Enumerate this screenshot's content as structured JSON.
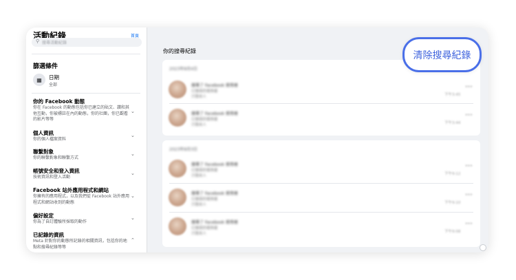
{
  "sidebar": {
    "title": "活動紀錄",
    "home_link": "首頁",
    "search_placeholder": "搜尋活動紀錄",
    "filter_title": "篩選條件",
    "date_filter": {
      "label": "日期",
      "value": "全部"
    },
    "categories": [
      {
        "title": "你的 Facebook 動態",
        "description": "你在 Facebook 的動態包括你已建立的貼文、讚和其他互動，你被標註在內的動態，你的社團，你已觀看的影片等等",
        "expanded": false
      },
      {
        "title": "個人資訊",
        "description": "你的個人檔案資料",
        "expanded": false
      },
      {
        "title": "聯繫對象",
        "description": "你的聯繫對象和聯繫方式",
        "expanded": false
      },
      {
        "title": "帳號安全和登入資訊",
        "description": "技術資訊和登入活動",
        "expanded": false
      },
      {
        "title": "Facebook 站外應用程式和網站",
        "description": "你擁有的應用程式，以及我們從 Facebook 站外應用程式和網站收到的動態",
        "expanded": false
      },
      {
        "title": "偏好設定",
        "description": "你為了自訂體驗所採取的動作",
        "expanded": false
      },
      {
        "title": "已記錄的資訊",
        "description": "Meta 針對你的動態所記錄的相關資訊，包括你的地點和搜尋紀錄等等",
        "expanded": true
      }
    ]
  },
  "main": {
    "title": "你的搜尋紀錄",
    "clear_button": "清除搜尋紀錄",
    "groups": [
      {
        "heading": "2023年8月4日",
        "rows": [
          {
            "line1": "搜尋了 Facebook 使用者",
            "line2": "已搜尋的使用者",
            "line3": "只限本人",
            "time": "下午3:45",
            "more": "•••"
          },
          {
            "line1": "搜尋了 Facebook 使用者",
            "line2": "已搜尋的使用者",
            "line3": "只限本人",
            "time": "下午3:44",
            "more": "•••"
          }
        ]
      },
      {
        "heading": "2023年8月3日",
        "rows": [
          {
            "line1": "搜尋了 Facebook 使用者",
            "line2": "已搜尋的使用者",
            "line3": "只限本人",
            "time": "下午9:12",
            "more": "•••"
          },
          {
            "line1": "搜尋了 Facebook 使用者",
            "line2": "已搜尋的使用者",
            "line3": "只限本人",
            "time": "下午9:10",
            "more": "•••"
          },
          {
            "line1": "搜尋了 Facebook 使用者",
            "line2": "已搜尋的使用者",
            "line3": "只限本人",
            "time": "下午9:08",
            "more": "•••"
          }
        ]
      }
    ]
  },
  "icons": {
    "search": "search-icon",
    "calendar": "calendar-icon",
    "chevron_down": "chevron-down-icon",
    "chevron_up": "chevron-up-icon"
  },
  "colors": {
    "accent": "#1877f2",
    "highlight": "#4a6fe8",
    "panel_bg": "#f0f2f5"
  }
}
